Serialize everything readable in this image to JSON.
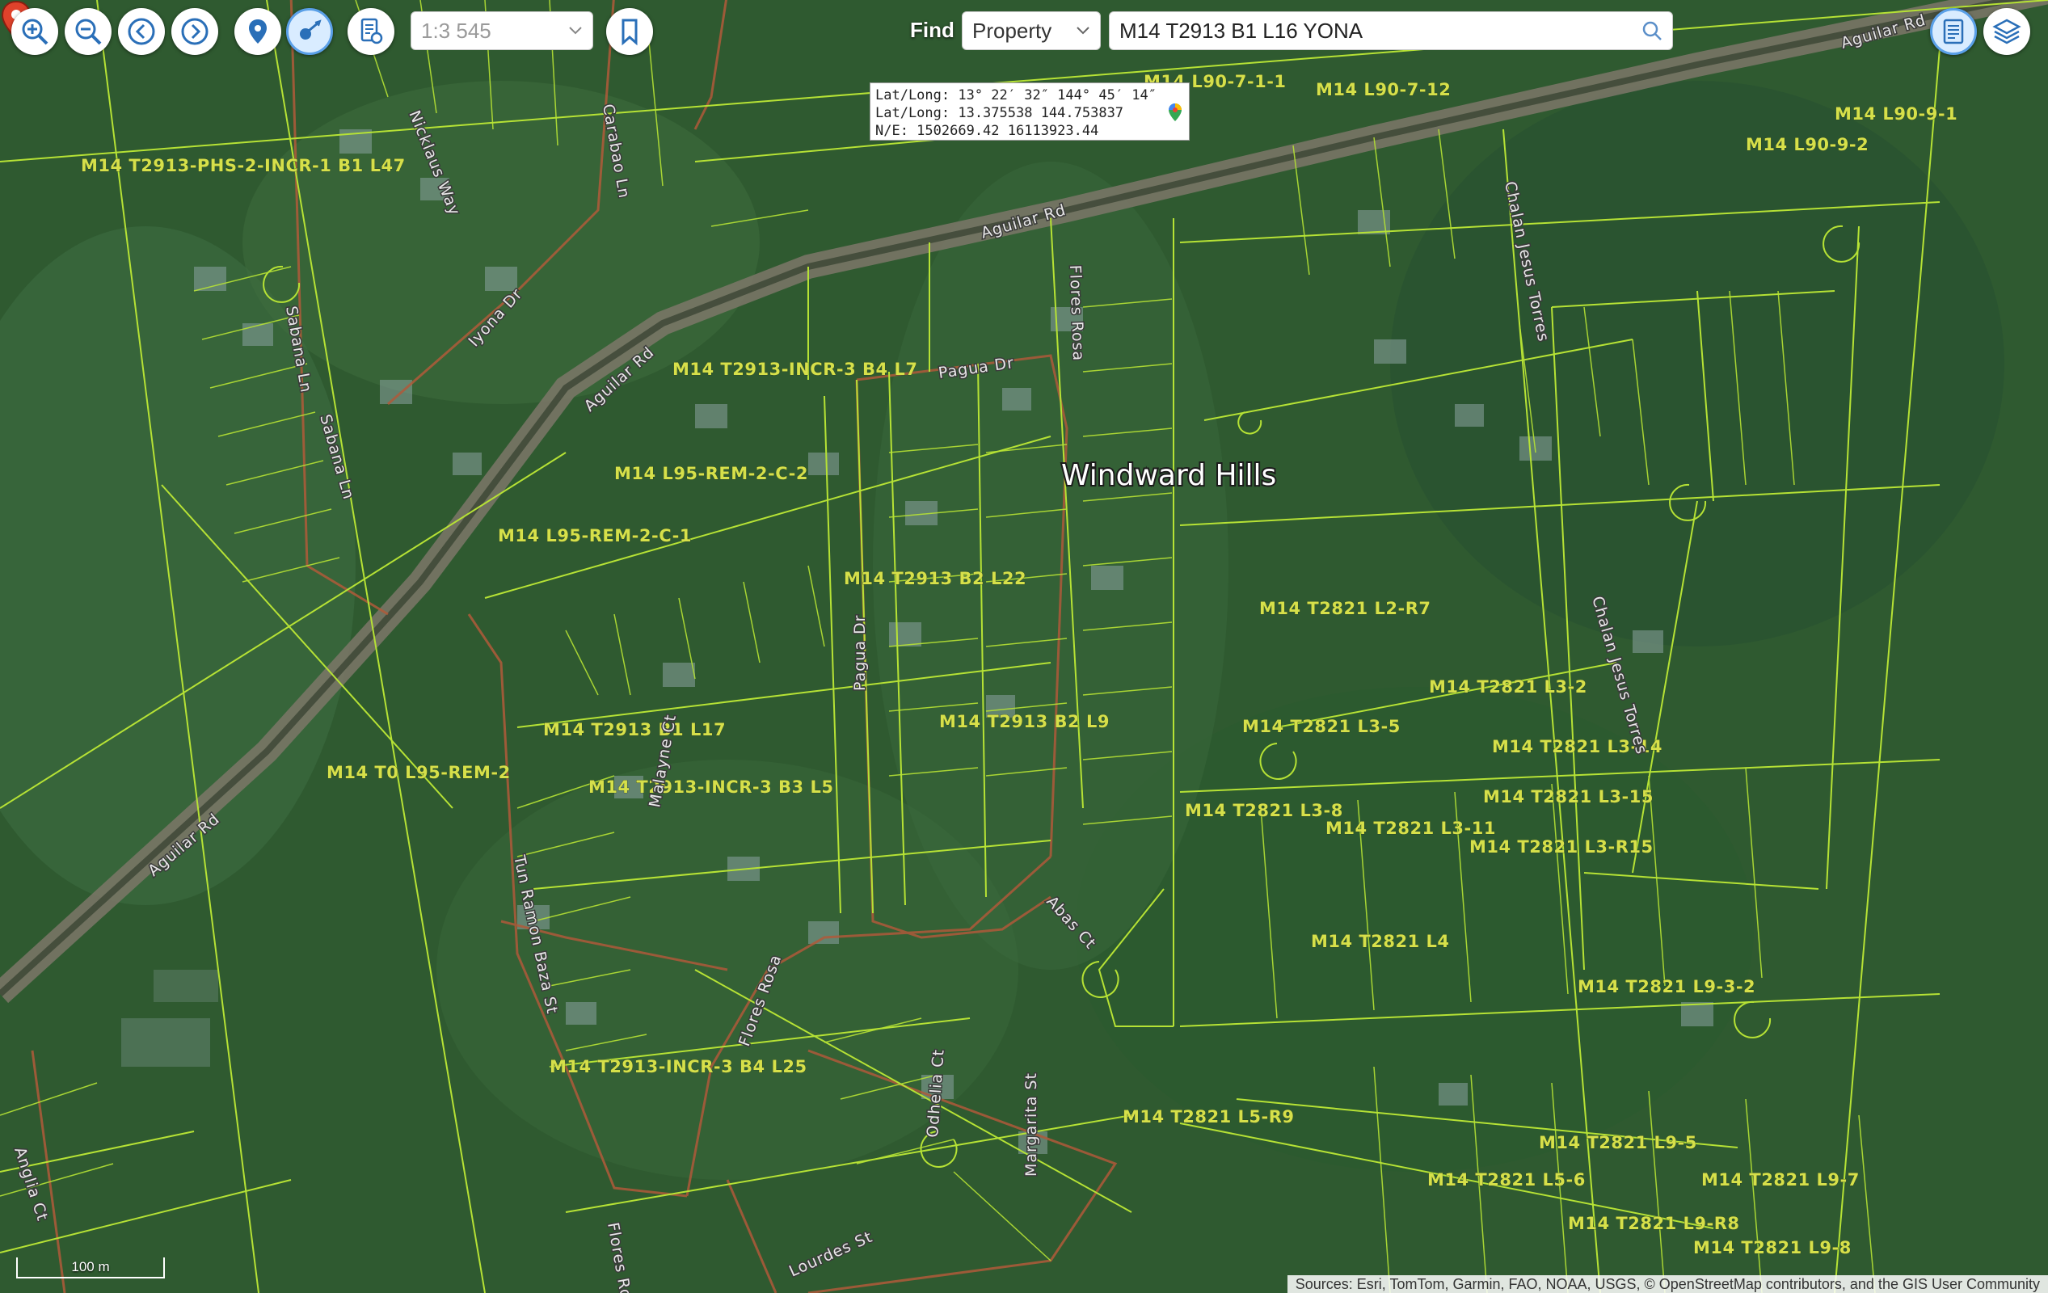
{
  "toolbar": {
    "zoom_in": "zoom-in-icon",
    "zoom_out": "zoom-out-icon",
    "back": "back-icon",
    "forward": "forward-icon",
    "locate": "location-pin-icon",
    "measure": "measure-icon",
    "report": "report-icon",
    "bookmark": "bookmark-icon",
    "scale_value": "1:3 545"
  },
  "find": {
    "label": "Find",
    "type_value": "Property",
    "query_value": "M14 T2913 B1 L16 YONA"
  },
  "right_buttons": {
    "document": "document-icon",
    "layers": "layers-icon"
  },
  "coordinates": {
    "dms": "Lat/Long: 13° 22′ 32″ 144° 45′ 14″",
    "decimal": "Lat/Long: 13.375538 144.753837",
    "ne": "N/E: 1502669.42 16113923.44"
  },
  "map": {
    "place_name": "Windward Hills",
    "parcels": [
      "M14 T2913-PHS-2-INCR-1 B1 L47",
      "M14 L90-7-1-1",
      "M14 L90-7-12",
      "M14 L90-9-1",
      "M14 L90-9-2",
      "M14 T2913-INCR-3 B4 L7",
      "M14 L95-REM-2-C-2",
      "M14 L95-REM-2-C-1",
      "M14 T2913 B2 L22",
      "M14 T2821 L2-R7",
      "M14 T2821 L3-2",
      "M14 T2821 L3-5",
      "M14 T2821 L3-14",
      "M14 T2913 B2 L9",
      "M14 T2913 B1 L17",
      "M14 T0 L95-REM-2",
      "M14 T2913-INCR-3 B3 L5",
      "M14 T2821 L3-15",
      "M14 T2821 L3-8",
      "M14 T2821 L3-11",
      "M14 T2821 L3-R15",
      "M14 T2821 L4",
      "M14 T2821 L9-3-2",
      "M14 T2913-INCR-3 B4 L25",
      "M14 T2821 L5-R9",
      "M14 T2821 L9-5",
      "M14 T2821 L5-6",
      "M14 T2821 L9-7",
      "M14 T2821 L9-R8",
      "M14 T2821 L9-8"
    ],
    "streets": [
      "Aguilar Rd",
      "Aguilar Rd",
      "Aguilar Rd",
      "Aguilar Rd",
      "Nicklaus Way",
      "Carabao Ln",
      "Iyona Dr",
      "Sabana Ln",
      "Sabana Ln",
      "Pagua Dr",
      "Flores Rosa",
      "Chalan Jesus Torres",
      "Chalan Jesus Torres",
      "Pagua Dr",
      "Malayne Ct",
      "Tun Ramon Baza St",
      "Abas Ct",
      "Flores Rosa",
      "Odhelia Ct",
      "Margarita St",
      "Lourdes St",
      "Flores Rosa",
      "Anglia Ct"
    ]
  },
  "scalebar": "100 m",
  "attribution": "Sources: Esri, TomTom, Garmin, FAO, NOAA, USGS, © OpenStreetMap contributors, and the GIS User Community",
  "colors": {
    "parcel_line": "#b6e235",
    "road": "#9a9486",
    "vegetation": "#2f5a30",
    "pin": "#e0422b"
  }
}
